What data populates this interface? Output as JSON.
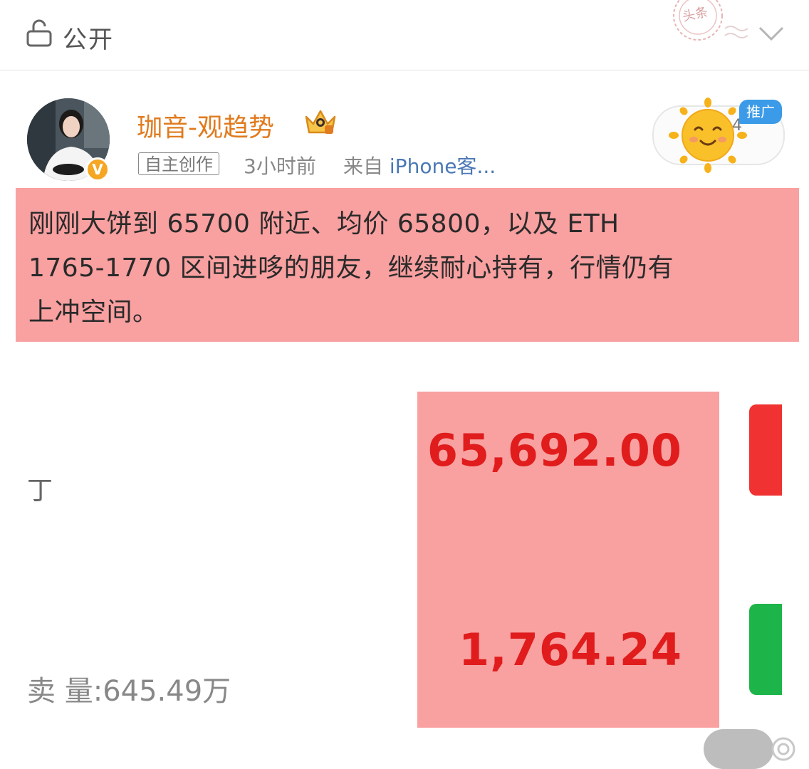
{
  "topbar": {
    "privacy_icon": "lock-icon",
    "privacy_label": "公开",
    "stamp_text": "头条",
    "expand_icon": "chevron-down-icon"
  },
  "post": {
    "author": "珈音-观趋势",
    "verified_badge": "V",
    "original_tag": "自主创作",
    "time": "3小时前",
    "source_prefix": "来自 ",
    "source_brand": "iPhone客...",
    "promo_label": "推广",
    "promo_digit": "4",
    "text_lines": [
      "刚刚大饼到 65700 附近、均价 65800，以及 ETH",
      "1765-1770 区间进哆的朋友，继续耐心持有，行情仍有",
      "上冲空间。"
    ]
  },
  "image": {
    "partial_char": "丁",
    "volume_text": "卖 量:645.49万",
    "btc_price": "65,692.00",
    "eth_price": "1,764.24"
  },
  "colors": {
    "author": "#e07b1f",
    "highlight": "#f9a0a0",
    "price": "#e01c1c",
    "up_bar": "#f03232",
    "down_bar": "#1db54a",
    "promo": "#3b9be8"
  }
}
